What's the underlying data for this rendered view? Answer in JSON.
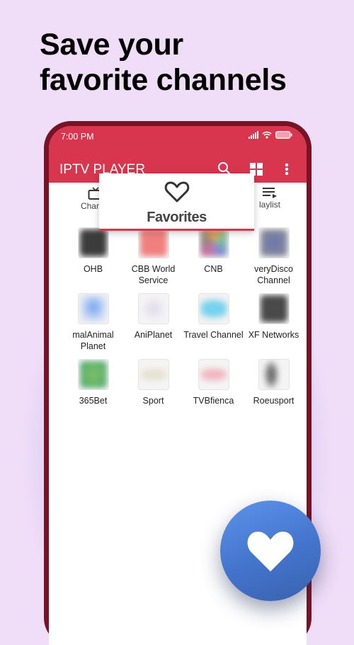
{
  "promo": {
    "headline_line1": "Save your",
    "headline_line2": "favorite channels"
  },
  "status_bar": {
    "time": "7:00 PM",
    "icons": [
      "signal-icon",
      "wifi-icon",
      "battery-icon"
    ]
  },
  "app_bar": {
    "title": "IPTV PLAYER",
    "actions": [
      "search-icon",
      "grid-view-icon",
      "more-vert-icon"
    ],
    "color": "#d8364e"
  },
  "tabs": [
    {
      "label": "Channels",
      "visible_text": "Channe",
      "icon": "tv-icon"
    },
    {
      "label": "Favorites",
      "icon": "heart-outline-icon",
      "active": true
    },
    {
      "label": "Playlist",
      "visible_text": "laylist",
      "icon": "playlist-icon"
    }
  ],
  "channels": [
    {
      "name": "OHB",
      "thumb": "#3c3c3c"
    },
    {
      "name": "CBB World Service",
      "thumb": "#f08080"
    },
    {
      "name": "CNB",
      "thumb": "#b9a0c0"
    },
    {
      "name": "veryDisco Channel",
      "thumb": "#7f86a8"
    },
    {
      "name": "malAnimal Planet",
      "thumb": "#7aa6f4"
    },
    {
      "name": "AniPlanet",
      "thumb": "#e3dcec"
    },
    {
      "name": "Travel Channel",
      "thumb": "#76d2ee"
    },
    {
      "name": "XF Networks",
      "thumb": "#4a4a4a"
    },
    {
      "name": "365Bet",
      "thumb": "#4faa7a"
    },
    {
      "name": "Sport",
      "thumb": "#e6e2d0"
    },
    {
      "name": "TVBfienca",
      "thumb": "#f2b6c0"
    },
    {
      "name": "Roeusport",
      "thumb": "#707070"
    }
  ],
  "favorites_popup": {
    "label": "Favorites",
    "icon": "heart-outline-icon"
  },
  "fab": {
    "icon": "heart-filled-icon",
    "color": "#4a7bd6"
  }
}
